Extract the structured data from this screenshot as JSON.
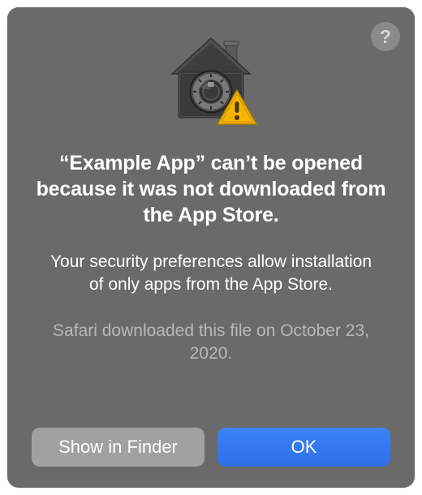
{
  "dialog": {
    "help_glyph": "?",
    "heading": "“Example App” can’t be opened because it was not downloaded from the App Store.",
    "subtext": "Your security preferences allow installation of only apps from the App Store.",
    "meta": "Safari downloaded this file on October 23, 2020.",
    "buttons": {
      "secondary": "Show in Finder",
      "primary": "OK"
    }
  },
  "icons": {
    "main": "gatekeeper-vault-icon",
    "warning": "warning-triangle-icon",
    "help": "help-icon"
  },
  "colors": {
    "bg": "#6a6a6a",
    "primary": "#2f6fe8",
    "secondary": "#a1a1a1",
    "warning": "#f7b500"
  }
}
